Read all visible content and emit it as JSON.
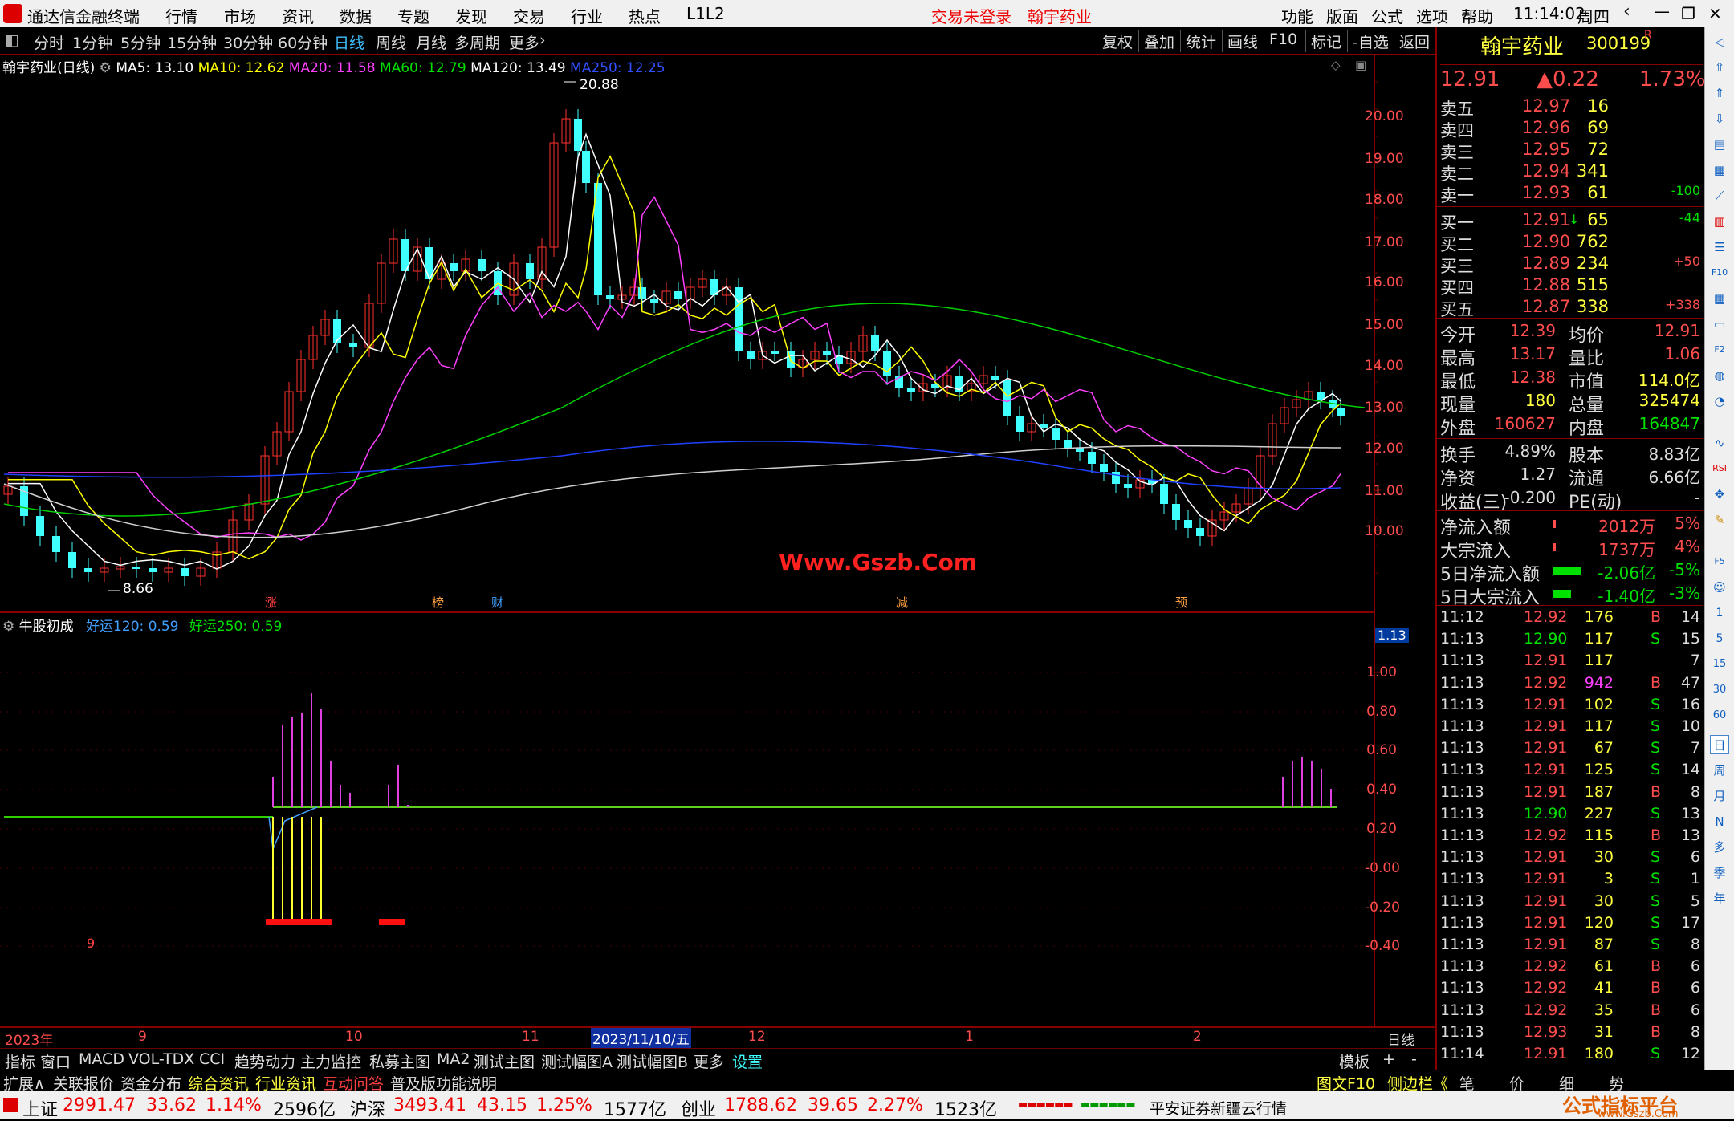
{
  "titlebar": {
    "app_name": "通达信金融终端",
    "menus": [
      "行情",
      "市场",
      "资讯",
      "数据",
      "专题",
      "发现",
      "交易",
      "行业",
      "热点",
      "L1L2"
    ],
    "login_status": "交易未登录",
    "stock_name": "翰宇药业",
    "right_menus": [
      "功能",
      "版面",
      "公式",
      "选项",
      "帮助"
    ],
    "time": "11:14:02",
    "weekday": "周四"
  },
  "period_bar": {
    "periods": [
      "分时",
      "1分钟",
      "5分钟",
      "15分钟",
      "30分钟",
      "60分钟",
      "日线",
      "周线",
      "月线",
      "多周期",
      "更多"
    ],
    "active": "日线",
    "tools": [
      "复权",
      "叠加",
      "统计",
      "画线",
      "F10",
      "标记",
      "-自选",
      "返回"
    ]
  },
  "main_chart": {
    "title": "翰宇药业(日线)",
    "ma": [
      {
        "label": "MA5: 13.10",
        "color": "#ffffff"
      },
      {
        "label": "MA10: 12.62",
        "color": "#ffff00"
      },
      {
        "label": "MA20: 11.58",
        "color": "#ff40ff"
      },
      {
        "label": "MA60: 12.79",
        "color": "#00e000"
      },
      {
        "label": "MA120: 13.49",
        "color": "#ffffff"
      },
      {
        "label": "MA250: 12.25",
        "color": "#3050ff"
      }
    ],
    "high_label": "20.88",
    "low_label": "8.66",
    "watermark": "Www.Gszb.Com",
    "y_ticks": [
      "20.00",
      "19.00",
      "18.00",
      "17.00",
      "16.00",
      "15.00",
      "14.00",
      "13.00",
      "12.00",
      "11.00",
      "10.00"
    ],
    "event_markers": [
      "涨",
      "榜",
      "财",
      "减",
      "预"
    ]
  },
  "indicator": {
    "name": "牛股初成",
    "lines": [
      {
        "label": "好运120: 0.59",
        "color": "#40a0ff"
      },
      {
        "label": "好运250: 0.59",
        "color": "#00e000"
      }
    ],
    "current_value": "1.13",
    "y_ticks": [
      "1.00",
      "0.80",
      "0.60",
      "0.40",
      "0.20",
      "-0.00",
      "-0.20",
      "-0.40"
    ],
    "note": "9"
  },
  "date_axis": {
    "labels": [
      "2023年",
      "9",
      "10",
      "11",
      "12",
      "1",
      "2"
    ],
    "cursor_date": "2023/11/10/五",
    "period": "日线"
  },
  "right_panel": {
    "stock_name": "翰宇药业",
    "code": "300199",
    "flag": "R",
    "price": "12.91",
    "change": "▲0.22",
    "pct": "1.73%",
    "asks": [
      {
        "label": "卖五",
        "price": "12.97",
        "vol": "16",
        "delta": ""
      },
      {
        "label": "卖四",
        "price": "12.96",
        "vol": "69",
        "delta": ""
      },
      {
        "label": "卖三",
        "price": "12.95",
        "vol": "72",
        "delta": ""
      },
      {
        "label": "卖二",
        "price": "12.94",
        "vol": "341",
        "delta": ""
      },
      {
        "label": "卖一",
        "price": "12.93",
        "vol": "61",
        "delta": "-100"
      }
    ],
    "bids": [
      {
        "label": "买一",
        "price": "12.91",
        "vol": "65",
        "delta": "-44"
      },
      {
        "label": "买二",
        "price": "12.90",
        "vol": "762",
        "delta": ""
      },
      {
        "label": "买三",
        "price": "12.89",
        "vol": "234",
        "delta": "+50"
      },
      {
        "label": "买四",
        "price": "12.88",
        "vol": "515",
        "delta": ""
      },
      {
        "label": "买五",
        "price": "12.87",
        "vol": "338",
        "delta": "+338"
      }
    ],
    "stats": [
      {
        "l1": "今开",
        "v1": "12.39",
        "l2": "均价",
        "v2": "12.91"
      },
      {
        "l1": "最高",
        "v1": "13.17",
        "l2": "量比",
        "v2": "1.06"
      },
      {
        "l1": "最低",
        "v1": "12.38",
        "l2": "市值",
        "v2": "114.0亿"
      },
      {
        "l1": "现量",
        "v1": "180",
        "l2": "总量",
        "v2": "325474"
      },
      {
        "l1": "外盘",
        "v1": "160627",
        "l2": "内盘",
        "v2": "164847"
      }
    ],
    "stats2": [
      {
        "l1": "换手",
        "v1": "4.89%",
        "l2": "股本",
        "v2": "8.83亿"
      },
      {
        "l1": "净资",
        "v1": "1.27",
        "l2": "流通",
        "v2": "6.66亿"
      },
      {
        "l1": "收益(三)",
        "v1": "-0.200",
        "l2": "PE(动)",
        "v2": "-"
      }
    ],
    "flows": [
      {
        "label": "净流入额",
        "value": "2012万",
        "pct": "5%",
        "color": "#ff4d4d",
        "bar": 0.03
      },
      {
        "label": "大宗流入",
        "value": "1737万",
        "pct": "4%",
        "color": "#ff4d4d",
        "bar": 0.03
      },
      {
        "label": "5日净流入额",
        "value": "-2.06亿",
        "pct": "-5%",
        "color": "#00e000",
        "bar": 0.4
      },
      {
        "label": "5日大宗流入",
        "value": "-1.40亿",
        "pct": "-3%",
        "color": "#00e000",
        "bar": 0.25
      }
    ],
    "ticks": [
      {
        "t": "11:12",
        "p": "12.92",
        "v": "176",
        "s": "B",
        "n": "14"
      },
      {
        "t": "11:13",
        "p": "12.90",
        "v": "117",
        "s": "S",
        "n": "15"
      },
      {
        "t": "11:13",
        "p": "12.91",
        "v": "117",
        "s": "",
        "n": "7"
      },
      {
        "t": "11:13",
        "p": "12.92",
        "v": "942",
        "s": "B",
        "n": "47"
      },
      {
        "t": "11:13",
        "p": "12.91",
        "v": "102",
        "s": "S",
        "n": "16"
      },
      {
        "t": "11:13",
        "p": "12.91",
        "v": "117",
        "s": "S",
        "n": "10"
      },
      {
        "t": "11:13",
        "p": "12.91",
        "v": "67",
        "s": "S",
        "n": "7"
      },
      {
        "t": "11:13",
        "p": "12.91",
        "v": "125",
        "s": "S",
        "n": "14"
      },
      {
        "t": "11:13",
        "p": "12.91",
        "v": "187",
        "s": "B",
        "n": "8"
      },
      {
        "t": "11:13",
        "p": "12.90",
        "v": "227",
        "s": "S",
        "n": "13"
      },
      {
        "t": "11:13",
        "p": "12.92",
        "v": "115",
        "s": "B",
        "n": "13"
      },
      {
        "t": "11:13",
        "p": "12.91",
        "v": "30",
        "s": "S",
        "n": "6"
      },
      {
        "t": "11:13",
        "p": "12.91",
        "v": "3",
        "s": "S",
        "n": "1"
      },
      {
        "t": "11:13",
        "p": "12.91",
        "v": "30",
        "s": "S",
        "n": "5"
      },
      {
        "t": "11:13",
        "p": "12.91",
        "v": "120",
        "s": "S",
        "n": "17"
      },
      {
        "t": "11:13",
        "p": "12.91",
        "v": "87",
        "s": "S",
        "n": "8"
      },
      {
        "t": "11:13",
        "p": "12.92",
        "v": "61",
        "s": "B",
        "n": "6"
      },
      {
        "t": "11:13",
        "p": "12.92",
        "v": "41",
        "s": "B",
        "n": "6"
      },
      {
        "t": "11:13",
        "p": "12.92",
        "v": "35",
        "s": "B",
        "n": "6"
      },
      {
        "t": "11:13",
        "p": "12.93",
        "v": "31",
        "s": "B",
        "n": "8"
      },
      {
        "t": "11:14",
        "p": "12.91",
        "v": "180",
        "s": "S",
        "n": "12"
      }
    ]
  },
  "bottom_tabs": [
    "指标",
    "窗口",
    "MACD",
    "VOL-TDX",
    "CCI",
    "趋势动力",
    "主力监控",
    "私募主图",
    "MA2",
    "测试主图",
    "测试幅图A",
    "测试幅图B",
    "更多",
    "设置"
  ],
  "bottom_right_tabs": [
    "模板",
    "+",
    "-"
  ],
  "info_tabs": [
    "扩展∧",
    "关联报价",
    "资金分布",
    "综合资讯",
    "行业资讯",
    "互动问答",
    "普及版功能说明"
  ],
  "info_right": [
    "图文F10",
    "侧边栏《",
    "笔",
    "价",
    "细",
    "势"
  ],
  "sidebar_right": [
    "日",
    "周",
    "月",
    "N",
    "多",
    "季",
    "年"
  ],
  "statusbar": {
    "idx1_name": "上证",
    "idx1_val": "2991.47",
    "idx1_chg": "33.62",
    "idx1_pct": "1.14%",
    "idx1_amt": "2596亿",
    "idx2_name": "沪深",
    "idx2_val": "3493.41",
    "idx2_chg": "43.15",
    "idx2_pct": "1.25%",
    "idx2_amt": "1577亿",
    "idx3_name": "创业",
    "idx3_val": "1788.62",
    "idx3_chg": "39.65",
    "idx3_pct": "2.27%",
    "idx3_amt": "1523亿",
    "broker": "平安证券新疆云行情",
    "logo_text": "公式指标平台",
    "logo_url": "www.Gszb.Com"
  }
}
